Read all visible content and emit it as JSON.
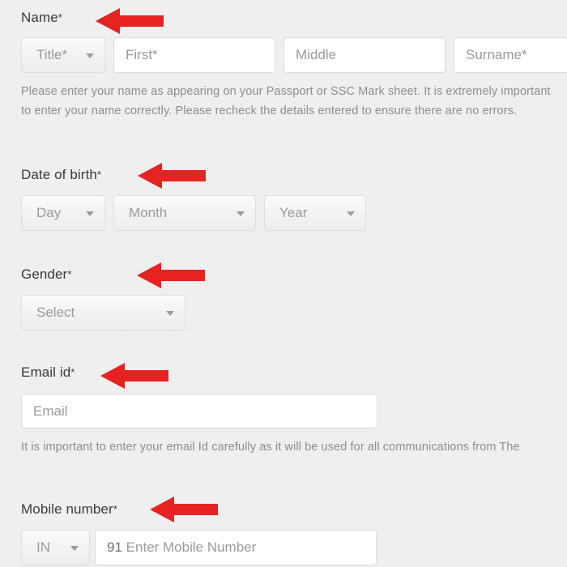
{
  "colors": {
    "page_background": "#efeff0",
    "label_text": "#3a3a3a",
    "placeholder_text": "#9a9a9a",
    "note_text": "#8d8d8d",
    "input_background": "#ffffff",
    "input_border": "#dcdcdc",
    "select_border": "#dedede",
    "caret": "#9b9b9b",
    "arrow_red": "#e62222"
  },
  "form": {
    "name": {
      "label": "Name",
      "required_mark": "*",
      "fields": {
        "title": {
          "placeholder": "Title*",
          "type": "select"
        },
        "first": {
          "placeholder": "First*",
          "type": "text"
        },
        "middle": {
          "placeholder": "Middle",
          "type": "text"
        },
        "surname": {
          "placeholder": "Surname*",
          "type": "text"
        }
      },
      "note_line_1": "Please enter your name as appearing on your Passport or SSC Mark sheet. It is extremely important",
      "note_line_2": "to enter your name correctly. Please recheck the details entered to ensure there are no errors."
    },
    "date_of_birth": {
      "label": "Date of birth",
      "required_mark": "*",
      "fields": {
        "day": {
          "placeholder": "Day",
          "type": "select"
        },
        "month": {
          "placeholder": "Month",
          "type": "select"
        },
        "year": {
          "placeholder": "Year",
          "type": "select"
        }
      }
    },
    "gender": {
      "label": "Gender",
      "required_mark": "*",
      "fields": {
        "gender": {
          "placeholder": "Select",
          "type": "select"
        }
      }
    },
    "email": {
      "label": "Email id",
      "required_mark": "*",
      "fields": {
        "email": {
          "placeholder": "Email",
          "type": "text"
        }
      },
      "note_line_1": "It is important to enter your email Id carefully as it will be used for all communications from The"
    },
    "mobile": {
      "label": "Mobile number",
      "required_mark": "*",
      "fields": {
        "country": {
          "placeholder": "IN",
          "type": "select"
        },
        "number": {
          "prefix": "91",
          "placeholder": "Enter Mobile Number",
          "type": "text"
        }
      }
    }
  },
  "annotations": {
    "arrows": [
      {
        "name": "arrow-pointing-at-name",
        "target": "Name"
      },
      {
        "name": "arrow-pointing-at-date-of-birth",
        "target": "Date of birth"
      },
      {
        "name": "arrow-pointing-at-gender",
        "target": "Gender"
      },
      {
        "name": "arrow-pointing-at-email-id",
        "target": "Email id"
      },
      {
        "name": "arrow-pointing-at-mobile-number",
        "target": "Mobile number"
      }
    ]
  }
}
